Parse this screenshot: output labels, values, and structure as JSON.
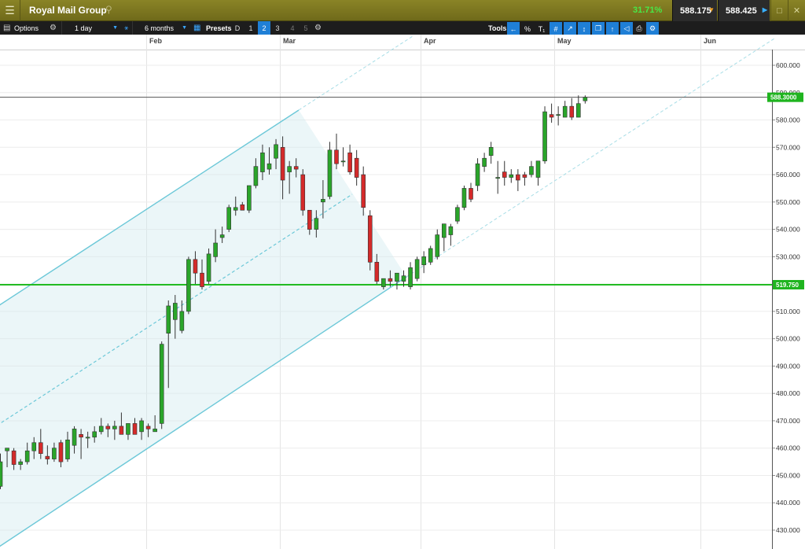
{
  "app": {
    "title": "Royal Mail Group",
    "change_pct": "31.71%",
    "sell_price": "588.175",
    "buy_price": "588.425"
  },
  "toolbar": {
    "options_label": "Options",
    "interval": "1 day",
    "range": "6 months",
    "presets_label": "Presets",
    "presets": [
      "D",
      "1",
      "2",
      "3",
      "4",
      "5"
    ],
    "active_preset": "2",
    "tools_label": "Tools",
    "tools": [
      "←",
      "%",
      "T₁",
      "#",
      "↗",
      "↕",
      "❐",
      "↑",
      "◁",
      "⎙",
      "⚙"
    ]
  },
  "chart_data": {
    "type": "candlestick",
    "x_labels": [
      "Feb",
      "Mar",
      "Apr",
      "May",
      "Jun"
    ],
    "y_ticks": [
      "600.000",
      "590.000",
      "580.000",
      "570.000",
      "560.000",
      "550.000",
      "540.000",
      "530.000",
      "520.000",
      "510.000",
      "500.000",
      "490.000",
      "480.000",
      "470.000",
      "460.000",
      "450.000",
      "440.000",
      "430.000"
    ],
    "ylim": [
      426,
      605
    ],
    "current_price_label": "588.3000",
    "horizontal_line_label": "519.750",
    "horizontal_line_value": 519.75,
    "current_price_value": 588.3,
    "colors": {
      "up": "#2aa52a",
      "down": "#d42a2a",
      "channel": "#6cc8d8",
      "support": "#22bb22",
      "current_price": "#555555"
    },
    "candles": [
      {
        "d": "Jan 14",
        "o": 446,
        "h": 458,
        "l": 445,
        "c": 455
      },
      {
        "d": "Jan 15",
        "o": 459,
        "h": 460,
        "l": 453,
        "c": 460
      },
      {
        "d": "Jan 16",
        "o": 459,
        "h": 460,
        "l": 452,
        "c": 454
      },
      {
        "d": "Jan 17",
        "o": 454,
        "h": 456,
        "l": 452,
        "c": 455
      },
      {
        "d": "Jan 20",
        "o": 455,
        "h": 462,
        "l": 454,
        "c": 459
      },
      {
        "d": "Jan 21",
        "o": 459,
        "h": 464,
        "l": 456,
        "c": 462
      },
      {
        "d": "Jan 22",
        "o": 462,
        "h": 467,
        "l": 456,
        "c": 458
      },
      {
        "d": "Jan 23",
        "o": 457,
        "h": 461,
        "l": 454,
        "c": 456
      },
      {
        "d": "Jan 24",
        "o": 456,
        "h": 462,
        "l": 455,
        "c": 460
      },
      {
        "d": "Jan 27",
        "o": 462,
        "h": 463,
        "l": 453,
        "c": 455
      },
      {
        "d": "Jan 28",
        "o": 456,
        "h": 466,
        "l": 455,
        "c": 463
      },
      {
        "d": "Jan 29",
        "o": 461,
        "h": 468,
        "l": 458,
        "c": 467
      },
      {
        "d": "Jan 30",
        "o": 465,
        "h": 467,
        "l": 456,
        "c": 464
      },
      {
        "d": "Jan 31",
        "o": 464,
        "h": 466,
        "l": 460,
        "c": 464
      },
      {
        "d": "Feb 3",
        "o": 464,
        "h": 468,
        "l": 462,
        "c": 466
      },
      {
        "d": "Feb 4",
        "o": 466,
        "h": 471,
        "l": 465,
        "c": 468
      },
      {
        "d": "Feb 5",
        "o": 468,
        "h": 469,
        "l": 464,
        "c": 467
      },
      {
        "d": "Feb 6",
        "o": 467,
        "h": 470,
        "l": 463,
        "c": 468
      },
      {
        "d": "Feb 7",
        "o": 468,
        "h": 473,
        "l": 465,
        "c": 465
      },
      {
        "d": "Feb 10",
        "o": 465,
        "h": 469,
        "l": 463,
        "c": 469
      },
      {
        "d": "Feb 11",
        "o": 469,
        "h": 471,
        "l": 465,
        "c": 465
      },
      {
        "d": "Feb 12",
        "o": 466,
        "h": 471,
        "l": 463,
        "c": 470
      },
      {
        "d": "Feb 13",
        "o": 468,
        "h": 469,
        "l": 464,
        "c": 467
      },
      {
        "d": "Feb 14",
        "o": 466,
        "h": 472,
        "l": 466,
        "c": 467
      },
      {
        "d": "Feb 17",
        "o": 469,
        "h": 499,
        "l": 467,
        "c": 498
      },
      {
        "d": "Feb 18",
        "o": 502,
        "h": 514,
        "l": 482,
        "c": 512
      },
      {
        "d": "Feb 19",
        "o": 507,
        "h": 516,
        "l": 500,
        "c": 513
      },
      {
        "d": "Feb 20",
        "o": 503,
        "h": 514,
        "l": 502,
        "c": 510
      },
      {
        "d": "Feb 21",
        "o": 510,
        "h": 530,
        "l": 509,
        "c": 529
      },
      {
        "d": "Feb 24",
        "o": 529,
        "h": 532,
        "l": 520,
        "c": 524
      },
      {
        "d": "Feb 25",
        "o": 524,
        "h": 529,
        "l": 518,
        "c": 519
      },
      {
        "d": "Feb 26",
        "o": 521,
        "h": 533,
        "l": 520,
        "c": 531
      },
      {
        "d": "Feb 27",
        "o": 530,
        "h": 540,
        "l": 528,
        "c": 535
      },
      {
        "d": "Feb 28",
        "o": 537,
        "h": 541,
        "l": 535,
        "c": 538
      },
      {
        "d": "Mar 3",
        "o": 540,
        "h": 549,
        "l": 539,
        "c": 548
      },
      {
        "d": "Mar 4",
        "o": 547,
        "h": 552,
        "l": 545,
        "c": 548
      },
      {
        "d": "Mar 5",
        "o": 549,
        "h": 550,
        "l": 547,
        "c": 547
      },
      {
        "d": "Mar 6",
        "o": 547,
        "h": 556,
        "l": 546,
        "c": 556
      },
      {
        "d": "Mar 7",
        "o": 556,
        "h": 566,
        "l": 555,
        "c": 563
      },
      {
        "d": "Mar 10",
        "o": 561,
        "h": 571,
        "l": 558,
        "c": 568
      },
      {
        "d": "Mar 11",
        "o": 562,
        "h": 570,
        "l": 560,
        "c": 564
      },
      {
        "d": "Mar 12",
        "o": 566,
        "h": 573,
        "l": 562,
        "c": 571
      },
      {
        "d": "Mar 13",
        "o": 570,
        "h": 574,
        "l": 551,
        "c": 558
      },
      {
        "d": "Mar 14",
        "o": 561,
        "h": 565,
        "l": 553,
        "c": 563
      },
      {
        "d": "Mar 17",
        "o": 563,
        "h": 566,
        "l": 559,
        "c": 562
      },
      {
        "d": "Mar 18",
        "o": 560,
        "h": 562,
        "l": 545,
        "c": 547
      },
      {
        "d": "Mar 19",
        "o": 547,
        "h": 543,
        "l": 538,
        "c": 540
      },
      {
        "d": "Mar 20",
        "o": 540,
        "h": 547,
        "l": 537,
        "c": 544
      },
      {
        "d": "Mar 21",
        "o": 550,
        "h": 558,
        "l": 544,
        "c": 551
      },
      {
        "d": "Mar 24",
        "o": 552,
        "h": 572,
        "l": 551,
        "c": 569
      },
      {
        "d": "Mar 25",
        "o": 569,
        "h": 575,
        "l": 562,
        "c": 564
      },
      {
        "d": "Mar 26",
        "o": 565,
        "h": 570,
        "l": 563,
        "c": 565
      },
      {
        "d": "Mar 27",
        "o": 568,
        "h": 571,
        "l": 560,
        "c": 561
      },
      {
        "d": "Mar 28",
        "o": 566,
        "h": 569,
        "l": 556,
        "c": 559
      },
      {
        "d": "Mar 31",
        "o": 560,
        "h": 563,
        "l": 545,
        "c": 548
      },
      {
        "d": "Apr 1",
        "o": 545,
        "h": 547,
        "l": 525,
        "c": 528
      },
      {
        "d": "Apr 2",
        "o": 528,
        "h": 531,
        "l": 520,
        "c": 521
      },
      {
        "d": "Apr 3",
        "o": 519,
        "h": 522,
        "l": 518,
        "c": 522
      },
      {
        "d": "Apr 4",
        "o": 522,
        "h": 525,
        "l": 519,
        "c": 521
      },
      {
        "d": "Apr 7",
        "o": 521,
        "h": 524,
        "l": 518,
        "c": 524
      },
      {
        "d": "Apr 8",
        "o": 521,
        "h": 525,
        "l": 519,
        "c": 523
      },
      {
        "d": "Apr 9",
        "o": 519,
        "h": 528,
        "l": 518,
        "c": 526
      },
      {
        "d": "Apr 10",
        "o": 522,
        "h": 530,
        "l": 521,
        "c": 529
      },
      {
        "d": "Apr 11",
        "o": 527,
        "h": 532,
        "l": 524,
        "c": 530
      },
      {
        "d": "Apr 14",
        "o": 528,
        "h": 534,
        "l": 527,
        "c": 533
      },
      {
        "d": "Apr 15",
        "o": 530,
        "h": 540,
        "l": 529,
        "c": 538
      },
      {
        "d": "Apr 16",
        "o": 537,
        "h": 542,
        "l": 532,
        "c": 542
      },
      {
        "d": "Apr 17",
        "o": 538,
        "h": 542,
        "l": 534,
        "c": 541
      },
      {
        "d": "Apr 22",
        "o": 543,
        "h": 549,
        "l": 542,
        "c": 548
      },
      {
        "d": "Apr 23",
        "o": 548,
        "h": 556,
        "l": 547,
        "c": 555
      },
      {
        "d": "Apr 24",
        "o": 555,
        "h": 557,
        "l": 550,
        "c": 551
      },
      {
        "d": "Apr 25",
        "o": 556,
        "h": 566,
        "l": 554,
        "c": 564
      },
      {
        "d": "Apr 28",
        "o": 563,
        "h": 568,
        "l": 561,
        "c": 566
      },
      {
        "d": "Apr 29",
        "o": 567,
        "h": 572,
        "l": 564,
        "c": 570
      },
      {
        "d": "Apr 30",
        "o": 559,
        "h": 565,
        "l": 553,
        "c": 559
      },
      {
        "d": "May 1",
        "o": 561,
        "h": 565,
        "l": 556,
        "c": 559
      },
      {
        "d": "May 2",
        "o": 559,
        "h": 562,
        "l": 557,
        "c": 560
      },
      {
        "d": "May 5",
        "o": 560,
        "h": 562,
        "l": 554,
        "c": 558
      },
      {
        "d": "May 6",
        "o": 560,
        "h": 561,
        "l": 556,
        "c": 559
      },
      {
        "d": "May 7",
        "o": 560,
        "h": 565,
        "l": 559,
        "c": 563
      },
      {
        "d": "May 8",
        "o": 559,
        "h": 565,
        "l": 556,
        "c": 565
      },
      {
        "d": "May 9",
        "o": 565,
        "h": 585,
        "l": 564,
        "c": 583
      },
      {
        "d": "May 12",
        "o": 582,
        "h": 586,
        "l": 579,
        "c": 581
      },
      {
        "d": "May 13",
        "o": 582,
        "h": 585,
        "l": 578,
        "c": 582
      },
      {
        "d": "May 14",
        "o": 581,
        "h": 587,
        "l": 581,
        "c": 585
      },
      {
        "d": "May 15",
        "o": 585,
        "h": 588,
        "l": 580,
        "c": 581
      },
      {
        "d": "May 16",
        "o": 581,
        "h": 589,
        "l": 581,
        "c": 586
      },
      {
        "d": "May 19",
        "o": 587,
        "h": 589,
        "l": 586,
        "c": 588.3
      }
    ]
  }
}
